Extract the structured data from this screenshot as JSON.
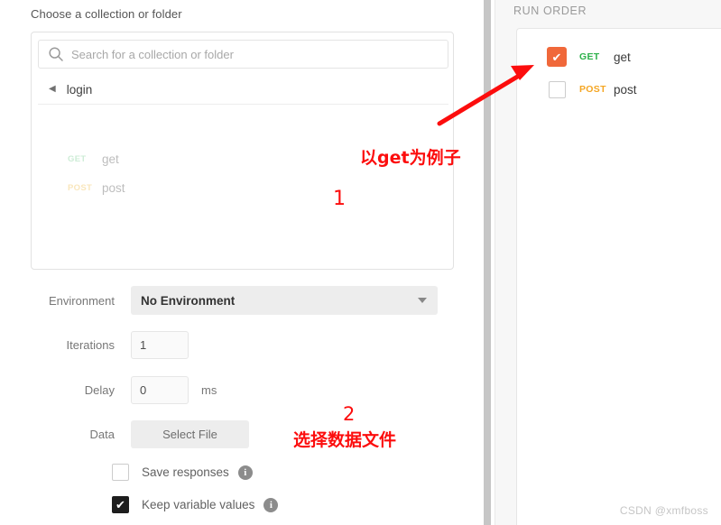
{
  "left": {
    "choose_label": "Choose a collection or folder",
    "search": {
      "placeholder": "Search for a collection or folder",
      "value": "",
      "icon": "search-icon"
    },
    "breadcrumb": {
      "back_icon": "caret-left-icon",
      "label": "login"
    },
    "requests": [
      {
        "method": "GET",
        "name": "get",
        "method_color": "#92d6a6"
      },
      {
        "method": "POST",
        "name": "post",
        "method_color": "#f3c96b"
      }
    ],
    "form": {
      "environment_label": "Environment",
      "environment_value": "No Environment",
      "environment_caret": "chevron-down-icon",
      "iterations_label": "Iterations",
      "iterations_value": "1",
      "delay_label": "Delay",
      "delay_value": "0",
      "delay_unit": "ms",
      "data_label": "Data",
      "select_file_label": "Select File",
      "save_responses_label": "Save responses",
      "save_responses_checked": false,
      "keep_variable_values_label": "Keep variable values",
      "keep_variable_values_checked": true,
      "info_icon_glyph": "i",
      "check_glyph": "✔"
    }
  },
  "right": {
    "title": "RUN ORDER",
    "items": [
      {
        "method": "GET",
        "name": "get",
        "method_color": "#2db14b",
        "checked": true
      },
      {
        "method": "POST",
        "name": "post",
        "method_color": "#f5a623",
        "checked": false
      }
    ],
    "check_glyph": "✔",
    "watermark": "CSDN @xmfboss"
  },
  "annotations": {
    "arrow_color": "#fc0d0d",
    "note_1_cn": "以get为例子",
    "marker_1": "1",
    "marker_2": "2",
    "note_2_cn": "选择数据文件"
  },
  "colors": {
    "accent_orange": "#f0683a",
    "annotation_red": "#fc0d0d",
    "panel_bg": "#f7f7f7"
  }
}
